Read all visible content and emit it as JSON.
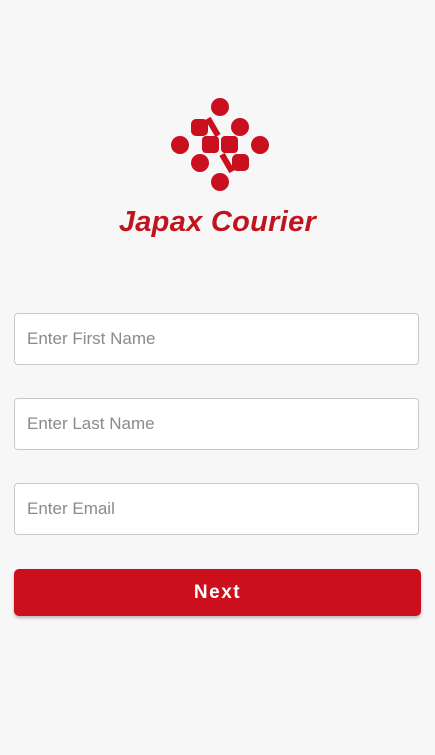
{
  "app": {
    "brand_name": "Japax Courier",
    "logo_icon": "japax-dots-logo",
    "brand_color": "#c0141f"
  },
  "form": {
    "first_name_placeholder": "Enter First Name",
    "last_name_placeholder": "Enter Last Name",
    "email_placeholder": "Enter Email",
    "first_name_value": "",
    "last_name_value": "",
    "email_value": "",
    "next_label": "Next",
    "button_color": "#cc0f1d"
  }
}
